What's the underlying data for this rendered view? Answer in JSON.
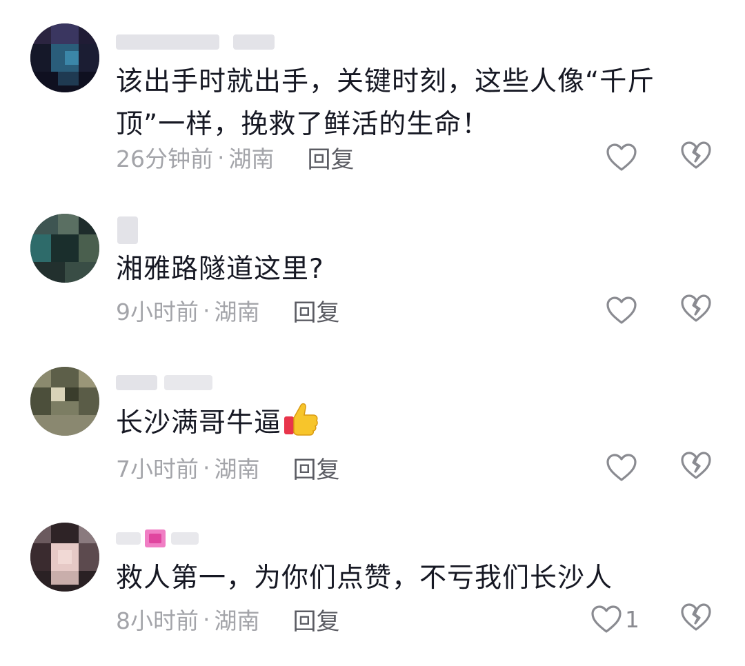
{
  "comments": [
    {
      "text": "该出手时就出手，关键时刻，这些人像“千斤顶”一样，挽救了鲜活的生命！",
      "time": "26分钟前",
      "separator": "·",
      "location": "湖南",
      "reply": "回复",
      "like_count": ""
    },
    {
      "text": "湘雅路隧道这里?",
      "time": "9小时前",
      "separator": "·",
      "location": "湖南",
      "reply": "回复",
      "like_count": ""
    },
    {
      "text": "长沙满哥牛逼",
      "emoji": "thumbs-up-emoji",
      "time": "7小时前",
      "separator": "·",
      "location": "湖南",
      "reply": "回复",
      "like_count": ""
    },
    {
      "text": "救人第一，为你们点赞，不亏我们长沙人",
      "time": "8小时前",
      "separator": "·",
      "location": "湖南",
      "reply": "回复",
      "like_count": "1"
    }
  ],
  "icons": {
    "like": "heart-outline-icon",
    "dislike": "broken-heart-icon"
  },
  "colors": {
    "text": "#161823",
    "meta": "#a3a4a9",
    "reply": "#5b5c63",
    "icon": "#8a8b91"
  }
}
